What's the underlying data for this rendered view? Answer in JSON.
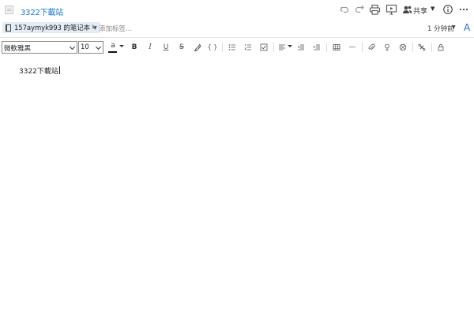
{
  "note": {
    "title": "3322下載站",
    "body_text": "3322下載站"
  },
  "header": {
    "share_label": "共享",
    "icons": [
      "undo-icon",
      "redo-icon",
      "print-icon",
      "present-icon",
      "share-people-icon",
      "info-icon",
      "more-icon"
    ]
  },
  "notebar": {
    "notebook_label": "157aymyk993 的笔记本",
    "tag_placeholder": "添加标签...",
    "modified_label": "1 分钟前",
    "font_glyph": "A"
  },
  "format": {
    "font_family": "微軟雅黑",
    "font_size": "10",
    "color_glyph": "a",
    "bold_glyph": "B",
    "italic_glyph": "I",
    "underline_glyph": "U",
    "strike_glyph": "S",
    "code_glyph": "{ }",
    "hr_glyph": "—"
  },
  "colors": {
    "accent": "#1a73c7",
    "chip_bg": "#e4edf6",
    "border": "#e2e2e2"
  }
}
